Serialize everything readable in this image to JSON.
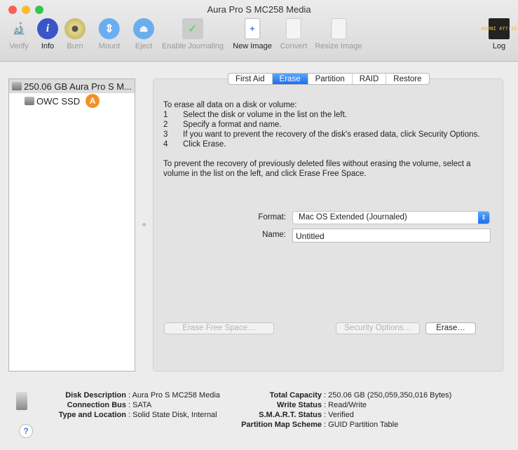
{
  "window": {
    "title": "Aura Pro S MC258 Media"
  },
  "toolbar": [
    {
      "label": "Verify",
      "icon": "microscope-icon",
      "enabled": false
    },
    {
      "label": "Info",
      "icon": "info-icon",
      "enabled": true
    },
    {
      "label": "Burn",
      "icon": "burn-icon",
      "enabled": false
    },
    {
      "label": "Mount",
      "icon": "mount-icon",
      "enabled": false
    },
    {
      "label": "Eject",
      "icon": "eject-icon",
      "enabled": false
    },
    {
      "label": "Enable Journaling",
      "icon": "journaling-icon",
      "enabled": false
    },
    {
      "label": "New Image",
      "icon": "new-image-icon",
      "enabled": true
    },
    {
      "label": "Convert",
      "icon": "convert-icon",
      "enabled": false
    },
    {
      "label": "Resize Image",
      "icon": "resize-image-icon",
      "enabled": false
    },
    {
      "label": "Log",
      "icon": "log-icon",
      "enabled": true,
      "icon_text": "WARNI 4Y7:36"
    }
  ],
  "sidebar": {
    "items": [
      {
        "label": "250.06 GB Aura Pro S M..."
      },
      {
        "label": "OWC SSD",
        "badge": "A"
      }
    ]
  },
  "tabs": [
    {
      "label": "First Aid"
    },
    {
      "label": "Erase",
      "active": true
    },
    {
      "label": "Partition"
    },
    {
      "label": "RAID"
    },
    {
      "label": "Restore"
    }
  ],
  "erase": {
    "intro": "To erase all data on a disk or volume:",
    "steps": [
      {
        "n": "1",
        "text": "Select the disk or volume in the list on the left."
      },
      {
        "n": "2",
        "text": "Specify a format and name."
      },
      {
        "n": "3",
        "text": "If you want to prevent the recovery of the disk's erased data, click Security Options."
      },
      {
        "n": "4",
        "text": "Click Erase."
      }
    ],
    "note": "To prevent the recovery of previously deleted files without erasing the volume, select a volume in the list on the left, and click Erase Free Space.",
    "format_label": "Format:",
    "format_value": "Mac OS Extended (Journaled)",
    "name_label": "Name:",
    "name_value": "Untitled",
    "erase_free_space": "Erase Free Space…",
    "security_options": "Security Options…",
    "erase": "Erase…"
  },
  "info": {
    "left": [
      {
        "k": "Disk Description",
        "v": "Aura Pro S MC258 Media"
      },
      {
        "k": "Connection Bus",
        "v": "SATA"
      },
      {
        "k": "Type and Location",
        "v": "Solid State Disk, Internal"
      }
    ],
    "right": [
      {
        "k": "Total Capacity",
        "v": "250.06 GB (250,059,350,016 Bytes)"
      },
      {
        "k": "Write Status",
        "v": "Read/Write"
      },
      {
        "k": "S.M.A.R.T. Status",
        "v": "Verified"
      },
      {
        "k": "Partition Map Scheme",
        "v": "GUID Partition Table"
      }
    ],
    "help": "?"
  },
  "colors": {
    "accent": "#1c6ef0",
    "badge": "#f0912a"
  }
}
